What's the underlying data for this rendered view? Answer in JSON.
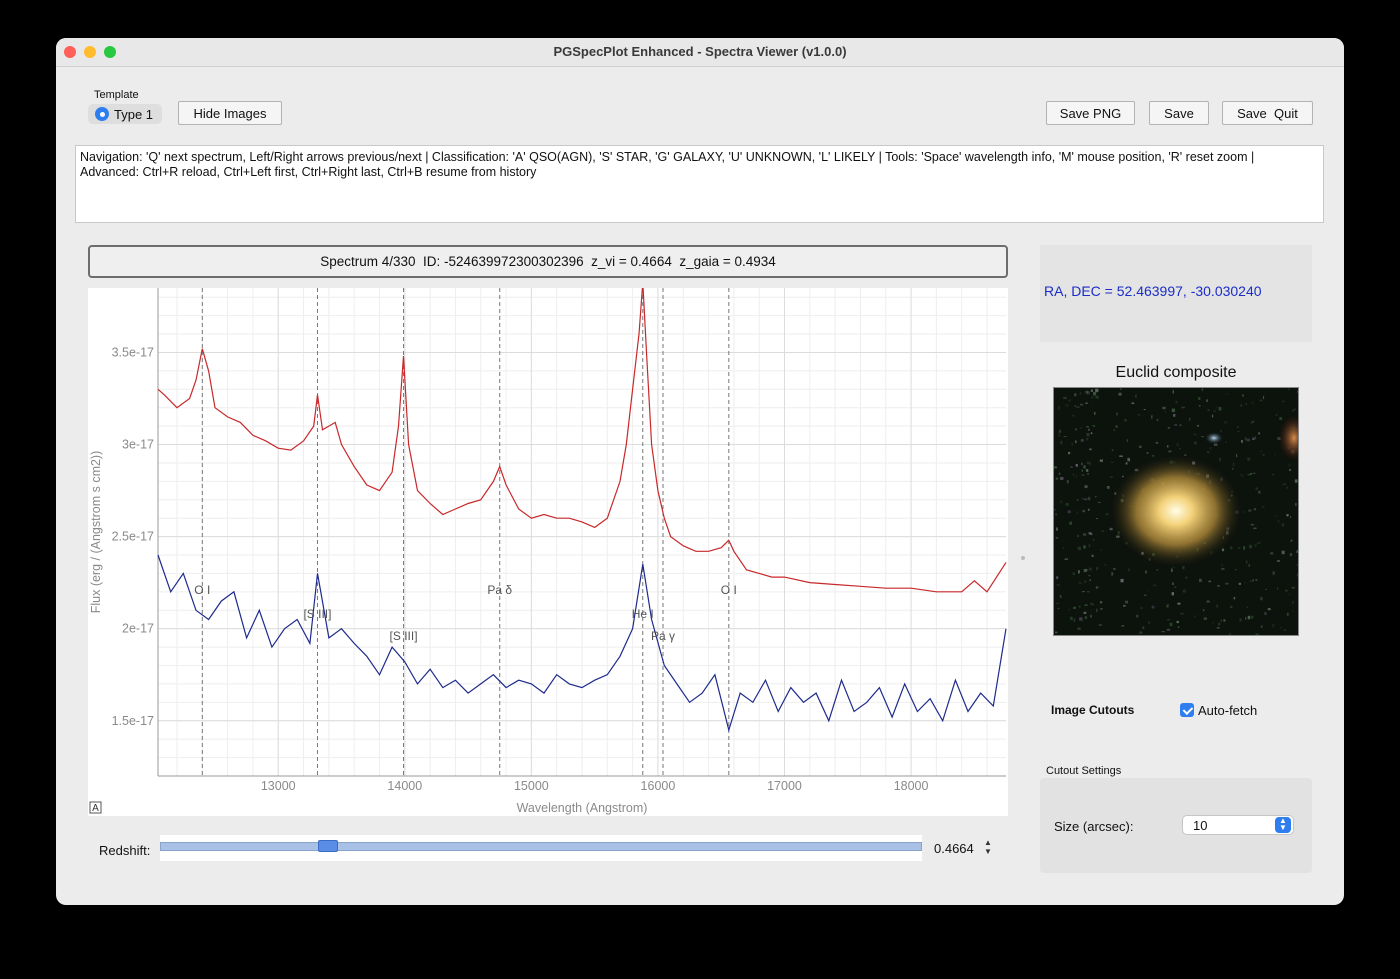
{
  "window": {
    "title": "PGSpecPlot Enhanced - Spectra Viewer (v1.0.0)"
  },
  "template": {
    "group_label": "Template",
    "option": "Type 1"
  },
  "toolbar": {
    "hide_images": "Hide Images",
    "save_png": "Save PNG",
    "save": "Save",
    "save_quit": "Save  Quit"
  },
  "help_text": {
    "line1": "Navigation: 'Q' next spectrum, Left/Right arrows previous/next | Classification: 'A' QSO(AGN), 'S' STAR, 'G' GALAXY, 'U' UNKNOWN, 'L' LIKELY | Tools: 'Space' wavelength info, 'M' mouse position, 'R' reset zoom |",
    "line2": "Advanced: Ctrl+R reload, Ctrl+Left first, Ctrl+Right last, Ctrl+B resume from history"
  },
  "spectrum_header": "Spectrum 4/330  ID: -524639972300302396  z_vi = 0.4664  z_gaia = 0.4934",
  "radec": "RA, DEC = 52.463997, -30.030240",
  "euclid": {
    "title": "Euclid composite"
  },
  "image_cutouts": {
    "label": "Image Cutouts",
    "autofetch_label": "Auto-fetch",
    "autofetch_checked": true
  },
  "cutout_settings": {
    "label": "Cutout Settings",
    "size_label": "Size (arcsec):",
    "size_value": "10"
  },
  "redshift": {
    "label": "Redshift:",
    "value": "0.4664",
    "slider_fraction": 0.22
  },
  "plot_badge": "A",
  "colors": {
    "spectrum1": "#c8282a",
    "spectrum2": "#1e2a8c",
    "accent": "#2f7ef0",
    "radec": "#1a2dc8"
  },
  "chart_data": {
    "type": "line",
    "xlabel": "Wavelength (Angstrom)",
    "ylabel": "Flux (erg / (Angstrom s cm2))",
    "xlim": [
      12050,
      18750
    ],
    "ylim": [
      1.2e-17,
      3.85e-17
    ],
    "x_ticks": [
      13000,
      14000,
      15000,
      16000,
      17000,
      18000
    ],
    "x_tick_labels": [
      "13000",
      "14000",
      "15000",
      "16000",
      "17000",
      "18000"
    ],
    "y_ticks": [
      1.5e-17,
      2e-17,
      2.5e-17,
      3e-17,
      3.5e-17
    ],
    "y_tick_labels": [
      "1.5e-17",
      "2e-17",
      "2.5e-17",
      "3e-17",
      "3.5e-17"
    ],
    "grid": true,
    "lines": [
      {
        "label": "O I",
        "x": 12400
      },
      {
        "label": "[S III]",
        "x": 13310
      },
      {
        "label": "[S III]",
        "x": 13990
      },
      {
        "label": "Pa δ",
        "x": 14750
      },
      {
        "label": "He I",
        "x": 15880
      },
      {
        "label": "Pa γ",
        "x": 16040
      },
      {
        "label": "O I",
        "x": 16560
      }
    ],
    "series": [
      {
        "color": "#c8282a",
        "x": [
          12050,
          12100,
          12200,
          12300,
          12350,
          12400,
          12450,
          12500,
          12600,
          12700,
          12800,
          12900,
          13000,
          13100,
          13200,
          13280,
          13310,
          13350,
          13400,
          13450,
          13500,
          13600,
          13700,
          13800,
          13900,
          13950,
          13990,
          14030,
          14100,
          14200,
          14300,
          14400,
          14500,
          14600,
          14700,
          14750,
          14800,
          14900,
          15000,
          15100,
          15200,
          15300,
          15400,
          15500,
          15600,
          15700,
          15750,
          15800,
          15850,
          15880,
          15910,
          15950,
          16000,
          16050,
          16100,
          16200,
          16300,
          16400,
          16500,
          16560,
          16600,
          16700,
          16800,
          16900,
          17000,
          17200,
          17400,
          17600,
          17800,
          18000,
          18200,
          18400,
          18500,
          18600,
          18750
        ],
        "values": [
          3.3e-17,
          3.27e-17,
          3.2e-17,
          3.25e-17,
          3.35e-17,
          3.52e-17,
          3.4e-17,
          3.2e-17,
          3.15e-17,
          3.12e-17,
          3.05e-17,
          3.02e-17,
          2.98e-17,
          2.97e-17,
          3.02e-17,
          3.1e-17,
          3.27e-17,
          3.08e-17,
          3.1e-17,
          3.12e-17,
          3e-17,
          2.88e-17,
          2.78e-17,
          2.75e-17,
          2.85e-17,
          3.1e-17,
          3.48e-17,
          3e-17,
          2.75e-17,
          2.68e-17,
          2.62e-17,
          2.65e-17,
          2.68e-17,
          2.7e-17,
          2.8e-17,
          2.88e-17,
          2.78e-17,
          2.65e-17,
          2.6e-17,
          2.62e-17,
          2.6e-17,
          2.6e-17,
          2.58e-17,
          2.55e-17,
          2.6e-17,
          2.8e-17,
          3e-17,
          3.3e-17,
          3.6e-17,
          3.88e-17,
          3.5e-17,
          3e-17,
          2.75e-17,
          2.6e-17,
          2.5e-17,
          2.45e-17,
          2.42e-17,
          2.42e-17,
          2.44e-17,
          2.48e-17,
          2.42e-17,
          2.32e-17,
          2.3e-17,
          2.28e-17,
          2.28e-17,
          2.25e-17,
          2.24e-17,
          2.23e-17,
          2.22e-17,
          2.22e-17,
          2.2e-17,
          2.2e-17,
          2.26e-17,
          2.2e-17,
          2.36e-17
        ]
      },
      {
        "color": "#1e2a8c",
        "x": [
          12050,
          12150,
          12250,
          12350,
          12450,
          12550,
          12650,
          12750,
          12850,
          12950,
          13050,
          13150,
          13250,
          13310,
          13400,
          13500,
          13600,
          13700,
          13800,
          13900,
          14000,
          14100,
          14200,
          14300,
          14400,
          14500,
          14600,
          14700,
          14800,
          14900,
          15000,
          15100,
          15200,
          15300,
          15400,
          15500,
          15600,
          15700,
          15800,
          15880,
          15950,
          16050,
          16150,
          16250,
          16350,
          16450,
          16560,
          16650,
          16750,
          16850,
          16950,
          17050,
          17150,
          17250,
          17350,
          17450,
          17550,
          17650,
          17750,
          17850,
          17950,
          18050,
          18150,
          18250,
          18350,
          18450,
          18550,
          18650,
          18750
        ],
        "values": [
          2.4e-17,
          2.2e-17,
          2.3e-17,
          2.1e-17,
          2.05e-17,
          2.15e-17,
          2.2e-17,
          1.95e-17,
          2.1e-17,
          1.9e-17,
          2e-17,
          2.05e-17,
          1.92e-17,
          2.3e-17,
          1.95e-17,
          2e-17,
          1.92e-17,
          1.85e-17,
          1.75e-17,
          1.9e-17,
          1.82e-17,
          1.7e-17,
          1.78e-17,
          1.68e-17,
          1.72e-17,
          1.65e-17,
          1.7e-17,
          1.75e-17,
          1.68e-17,
          1.72e-17,
          1.7e-17,
          1.65e-17,
          1.75e-17,
          1.7e-17,
          1.68e-17,
          1.72e-17,
          1.75e-17,
          1.85e-17,
          2e-17,
          2.35e-17,
          2.05e-17,
          1.8e-17,
          1.7e-17,
          1.6e-17,
          1.65e-17,
          1.75e-17,
          1.45e-17,
          1.65e-17,
          1.6e-17,
          1.72e-17,
          1.55e-17,
          1.68e-17,
          1.6e-17,
          1.65e-17,
          1.5e-17,
          1.72e-17,
          1.55e-17,
          1.6e-17,
          1.68e-17,
          1.52e-17,
          1.7e-17,
          1.55e-17,
          1.62e-17,
          1.5e-17,
          1.72e-17,
          1.55e-17,
          1.65e-17,
          1.58e-17,
          2e-17
        ]
      }
    ]
  }
}
